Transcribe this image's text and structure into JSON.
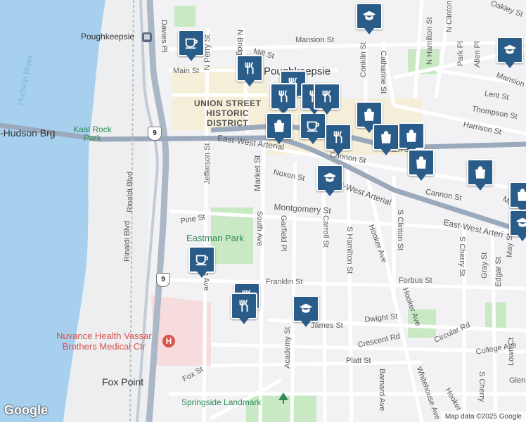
{
  "map": {
    "labels": {
      "poughkeepsie_station": "Poughkeepsie",
      "poughkeepsie_city": "Poughkeepsie",
      "hudson_river": "Hudson River",
      "hudson_brg": "-Hudson Brg",
      "kaal_rock_park": "Kaal Rock\nPark",
      "union_street_district": "UNION STREET\nHISTORIC\nDISTRICT",
      "eastman_park": "Eastman Park",
      "hospital": "Nuvance Health Vassar\nBrothers Medical Ctr",
      "fox_point": "Fox Point",
      "springside": "Springside Landmark",
      "east_west_arterial_1": "East-West Arterial",
      "east_west_arterial_2": "East-West Arterial",
      "east_west_arterial_3": "East-West Arteri",
      "mansion_st": "Mansion St",
      "mansion_right": "Mansion",
      "mill_st": "Mill St",
      "main_st_left": "Main St",
      "main_st_mid": "Main St",
      "main_right": "Main",
      "cannon_st_1": "Cannon St",
      "cannon_st_2": "Cannon St",
      "noxon_st": "Noxon St",
      "montgomery_st": "Montgomery St",
      "pine_st": "Pine St",
      "franklin_st": "Franklin St",
      "forbus_st": "Forbus St",
      "dwight_st": "Dwight St",
      "james_st": "James St",
      "crescent_rd": "Crescent Rd",
      "platt_st": "Platt St",
      "circular_rd": "Circular Rd",
      "college_ave": "College Ave",
      "fox_st": "Fox St",
      "lent_st": "Lent St",
      "thompson_st": "Thompson St",
      "harrison_st": "Harrison St",
      "oakley_st": "Oakley St",
      "davies_pl": "Davies Pl",
      "n_perry_st": "N Perry St",
      "n_bridge_st": "N Bridge St",
      "market_st": "Market St",
      "south_ave": "South Ave",
      "jefferson_st": "Jefferson St",
      "garfield_pl": "Garfield Pl",
      "carroll_st": "Carroll St",
      "s_hamilton_st": "S Hamilton St",
      "hooker_ave_1": "Hooker Ave",
      "hooker_ave_2": "Hooker Ave",
      "hooker_ave_3": "Hooker",
      "s_clinton_st": "S Clinton St",
      "s_cherry_st": "S Cherry St",
      "gray_st": "Gray St",
      "edgar_st": "Edgar St",
      "may_st": "May St",
      "lown_ct": "Lown Ct",
      "s_cherry_2": "S Cherry",
      "glen": "Glen",
      "rinaldi_blvd_1": "Rinaldi Blvd",
      "rinaldi_blvd_2": "Rinaldi Blvd",
      "academy_st": "Academy St",
      "barnard_ave": "Barnard Ave",
      "whitehouse_ave": "Whitehouse Ave",
      "conklin_st": "Conklin St",
      "catharine_st": "Catharine St",
      "n_hamilton_st": "N Hamilton St",
      "n_clinton_st": "N Clinton St",
      "park_pl": "Park Pl",
      "allen_pl": "Allen Pl",
      "ave_label": "h Ave"
    },
    "shields": [
      "9",
      "9"
    ],
    "pins": [
      {
        "icon": "cup-icon"
      },
      {
        "icon": "cup-icon"
      },
      {
        "icon": "cup-icon"
      },
      {
        "icon": "fork-knife-icon"
      },
      {
        "icon": "fork-knife-icon"
      },
      {
        "icon": "fork-knife-icon"
      },
      {
        "icon": "fork-knife-icon"
      },
      {
        "icon": "fork-knife-icon"
      },
      {
        "icon": "fork-knife-icon"
      },
      {
        "icon": "fork-knife-icon"
      },
      {
        "icon": "fork-knife-icon"
      },
      {
        "icon": "bag-icon"
      },
      {
        "icon": "bag-icon"
      },
      {
        "icon": "bag-icon"
      },
      {
        "icon": "bag-icon"
      },
      {
        "icon": "bag-icon"
      },
      {
        "icon": "bag-icon"
      },
      {
        "icon": "bag-icon"
      },
      {
        "icon": "school-icon"
      },
      {
        "icon": "school-icon"
      },
      {
        "icon": "school-icon"
      },
      {
        "icon": "school-icon"
      }
    ],
    "colors": {
      "water": "#a7d0ef",
      "pin": "#2a5c8a",
      "park": "#c9e8c4",
      "arterial": "#9aa9bb",
      "highway": "#aab7c6"
    }
  },
  "footer": {
    "logo": "Google",
    "credit": "Map data ©2025 Google"
  }
}
